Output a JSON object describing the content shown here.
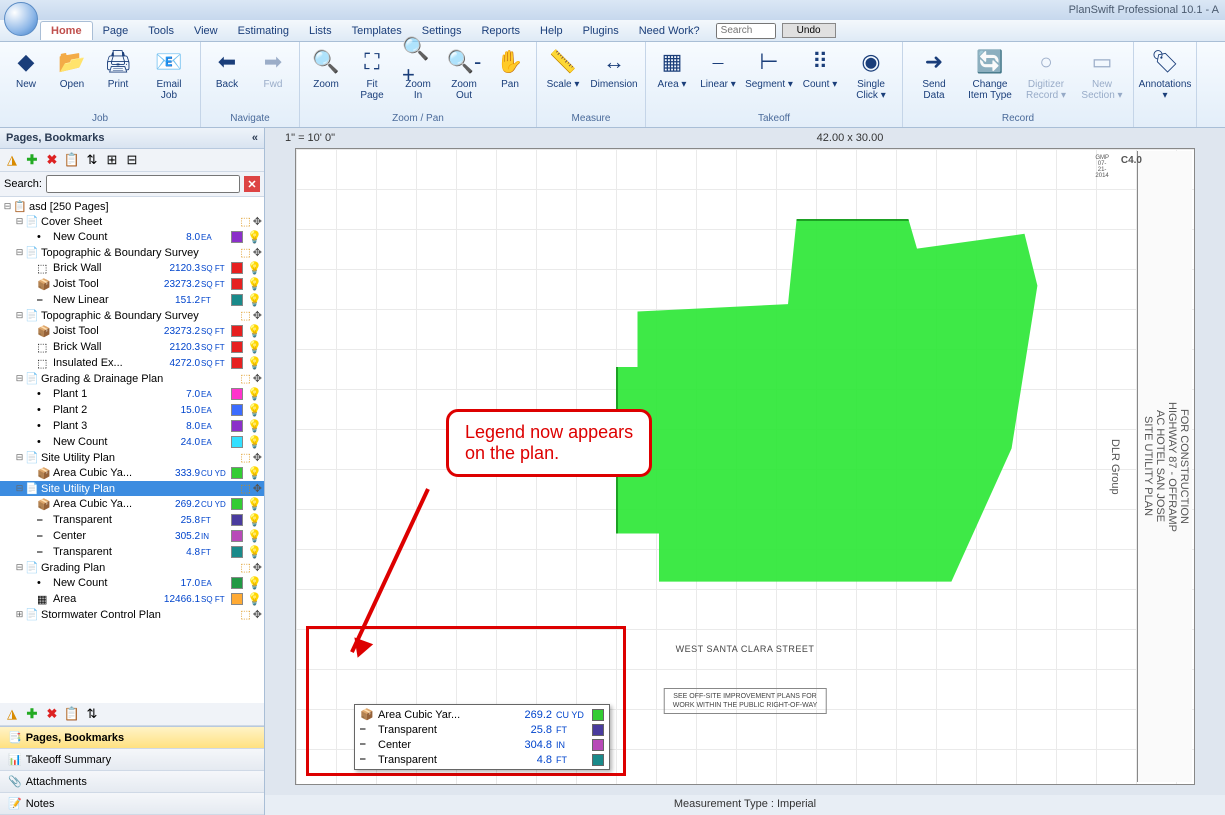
{
  "title": "PlanSwift Professional 10.1 - A",
  "menu": {
    "tabs": [
      "Home",
      "Page",
      "Tools",
      "View",
      "Estimating",
      "Lists",
      "Templates",
      "Settings",
      "Reports",
      "Help",
      "Plugins",
      "Need Work?"
    ],
    "search_ph": "Search",
    "undo": "Undo"
  },
  "ribbon": {
    "job": {
      "title": "Job",
      "items": [
        {
          "l": "New",
          "i": "◆"
        },
        {
          "l": "Open",
          "i": "📂"
        },
        {
          "l": "Print",
          "i": "🖨"
        },
        {
          "l": "Email Job",
          "i": "📧"
        }
      ]
    },
    "nav": {
      "title": "Navigate",
      "items": [
        {
          "l": "Back",
          "i": "⬅"
        },
        {
          "l": "Fwd",
          "i": "➡",
          "d": 1
        }
      ]
    },
    "zoom": {
      "title": "Zoom / Pan",
      "items": [
        {
          "l": "Zoom",
          "i": "🔍"
        },
        {
          "l": "Fit Page",
          "i": "⛶"
        },
        {
          "l": "Zoom In",
          "i": "🔍+"
        },
        {
          "l": "Zoom Out",
          "i": "🔍-"
        },
        {
          "l": "Pan",
          "i": "✋"
        }
      ]
    },
    "meas": {
      "title": "Measure",
      "items": [
        {
          "l": "Scale ▾",
          "i": "📏"
        },
        {
          "l": "Dimension",
          "i": "↔"
        }
      ]
    },
    "take": {
      "title": "Takeoff",
      "items": [
        {
          "l": "Area ▾",
          "i": "▦"
        },
        {
          "l": "Linear ▾",
          "i": "⎯"
        },
        {
          "l": "Segment ▾",
          "i": "⊢"
        },
        {
          "l": "Count ▾",
          "i": "⠿"
        },
        {
          "l": "Single Click ▾",
          "i": "◉"
        }
      ]
    },
    "rec": {
      "title": "Record",
      "items": [
        {
          "l": "Send Data",
          "i": "➜"
        },
        {
          "l": "Change Item Type",
          "i": "🔄"
        },
        {
          "l": "Digitizer Record ▾",
          "i": "○",
          "d": 1
        },
        {
          "l": "New Section ▾",
          "i": "▭",
          "d": 1
        }
      ]
    },
    "ann": {
      "title": "",
      "items": [
        {
          "l": "Annotations ▾",
          "i": "🏷"
        }
      ]
    }
  },
  "sidebar": {
    "title": "Pages, Bookmarks",
    "search_lbl": "Search:",
    "tabs": [
      "Pages, Bookmarks",
      "Takeoff Summary",
      "Attachments",
      "Notes"
    ],
    "tree": [
      {
        "d": 0,
        "e": "⊟",
        "i": "📋",
        "t": "asd [250 Pages]"
      },
      {
        "d": 1,
        "e": "⊟",
        "i": "📄",
        "t": "Cover Sheet",
        "tags": 1
      },
      {
        "d": 2,
        "i": "•",
        "t": "New Count",
        "v": "8.0",
        "u": "EA",
        "c": "#8b2fc9"
      },
      {
        "d": 1,
        "e": "⊟",
        "i": "📄",
        "t": "Topographic & Boundary Survey",
        "tags": 1
      },
      {
        "d": 2,
        "i": "⬚",
        "t": "Brick Wall",
        "v": "2120.3",
        "u": "SQ FT",
        "c": "#e62020"
      },
      {
        "d": 2,
        "i": "📦",
        "t": "Joist Tool",
        "v": "23273.2",
        "u": "SQ FT",
        "c": "#e62020"
      },
      {
        "d": 2,
        "i": "⎯",
        "t": "New Linear",
        "v": "151.2",
        "u": "FT",
        "c": "#1a8a8a"
      },
      {
        "d": 1,
        "e": "⊟",
        "i": "📄",
        "t": "Topographic & Boundary Survey",
        "tags": 1
      },
      {
        "d": 2,
        "i": "📦",
        "t": "Joist Tool",
        "v": "23273.2",
        "u": "SQ FT",
        "c": "#e62020"
      },
      {
        "d": 2,
        "i": "⬚",
        "t": "Brick Wall",
        "v": "2120.3",
        "u": "SQ FT",
        "c": "#e62020"
      },
      {
        "d": 2,
        "i": "⬚",
        "t": "Insulated Ex...",
        "v": "4272.0",
        "u": "SQ FT",
        "c": "#e62020"
      },
      {
        "d": 1,
        "e": "⊟",
        "i": "📄",
        "t": "Grading & Drainage Plan",
        "tags": 1
      },
      {
        "d": 2,
        "i": "•",
        "t": "Plant 1",
        "v": "7.0",
        "u": "EA",
        "c": "#ff33cc"
      },
      {
        "d": 2,
        "i": "•",
        "t": "Plant 2",
        "v": "15.0",
        "u": "EA",
        "c": "#3c6cff"
      },
      {
        "d": 2,
        "i": "•",
        "t": "Plant 3",
        "v": "8.0",
        "u": "EA",
        "c": "#8b2fc9"
      },
      {
        "d": 2,
        "i": "•",
        "t": "New Count",
        "v": "24.0",
        "u": "EA",
        "c": "#33e0ff"
      },
      {
        "d": 1,
        "e": "⊟",
        "i": "📄",
        "t": "Site Utility Plan",
        "tags": 1
      },
      {
        "d": 2,
        "i": "📦",
        "t": "Area Cubic Ya...",
        "v": "333.9",
        "u": "CU YD",
        "c": "#33cc33"
      },
      {
        "d": 1,
        "e": "⊟",
        "i": "📄",
        "t": "Site Utility Plan",
        "sel": 1,
        "tags": 1
      },
      {
        "d": 2,
        "i": "📦",
        "t": "Area Cubic Ya...",
        "v": "269.2",
        "u": "CU YD",
        "c": "#33cc33"
      },
      {
        "d": 2,
        "i": "⎯",
        "t": "Transparent",
        "v": "25.8",
        "u": "FT",
        "c": "#4a3c9e"
      },
      {
        "d": 2,
        "i": "⎯",
        "t": "Center",
        "v": "305.2",
        "u": "IN",
        "c": "#b84ab8"
      },
      {
        "d": 2,
        "i": "⎯",
        "t": "Transparent",
        "v": "4.8",
        "u": "FT",
        "c": "#1a8a8a"
      },
      {
        "d": 1,
        "e": "⊟",
        "i": "📄",
        "t": "Grading Plan",
        "tags": 1
      },
      {
        "d": 2,
        "i": "•",
        "t": "New Count",
        "v": "17.0",
        "u": "EA",
        "c": "#229944"
      },
      {
        "d": 2,
        "i": "▦",
        "t": "Area",
        "v": "12466.1",
        "u": "SQ FT",
        "c": "#ffaa33"
      },
      {
        "d": 1,
        "e": "⊞",
        "i": "📄",
        "t": "Stormwater Control Plan",
        "tags": 1
      }
    ]
  },
  "canvas": {
    "scale": "1\" = 10' 0\"",
    "dims": "42.00 x 30.00",
    "street": "WEST SANTA CLARA STREET",
    "titleblock": {
      "l1": "SITE UTILITY PLAN",
      "l2": "AC HOTEL SAN JOSE",
      "l3": "HIGHWAY 87 - OFFRAMP",
      "l4": "FOR CONSTRUCTION",
      "sheet": "C4.0",
      "firm": "DLR Group",
      "date": "GMP 07-21-2014"
    },
    "offsite": "SEE OFF-SITE IMPROVEMENT PLANS FOR\nWORK WITHIN THE PUBLIC RIGHT-OF-WAY",
    "status": "Measurement Type : Imperial"
  },
  "callout": "Legend now appears on the plan.",
  "legend": [
    {
      "i": "📦",
      "n": "Area Cubic Yar...",
      "v": "269.2",
      "u": "CU YD",
      "c": "#33cc33"
    },
    {
      "i": "⎯",
      "n": "Transparent",
      "v": "25.8",
      "u": "FT",
      "c": "#4a3c9e"
    },
    {
      "i": "⎯",
      "n": "Center",
      "v": "304.8",
      "u": "IN",
      "c": "#b84ab8"
    },
    {
      "i": "⎯",
      "n": "Transparent",
      "v": "4.8",
      "u": "FT",
      "c": "#1a8a8a"
    }
  ]
}
